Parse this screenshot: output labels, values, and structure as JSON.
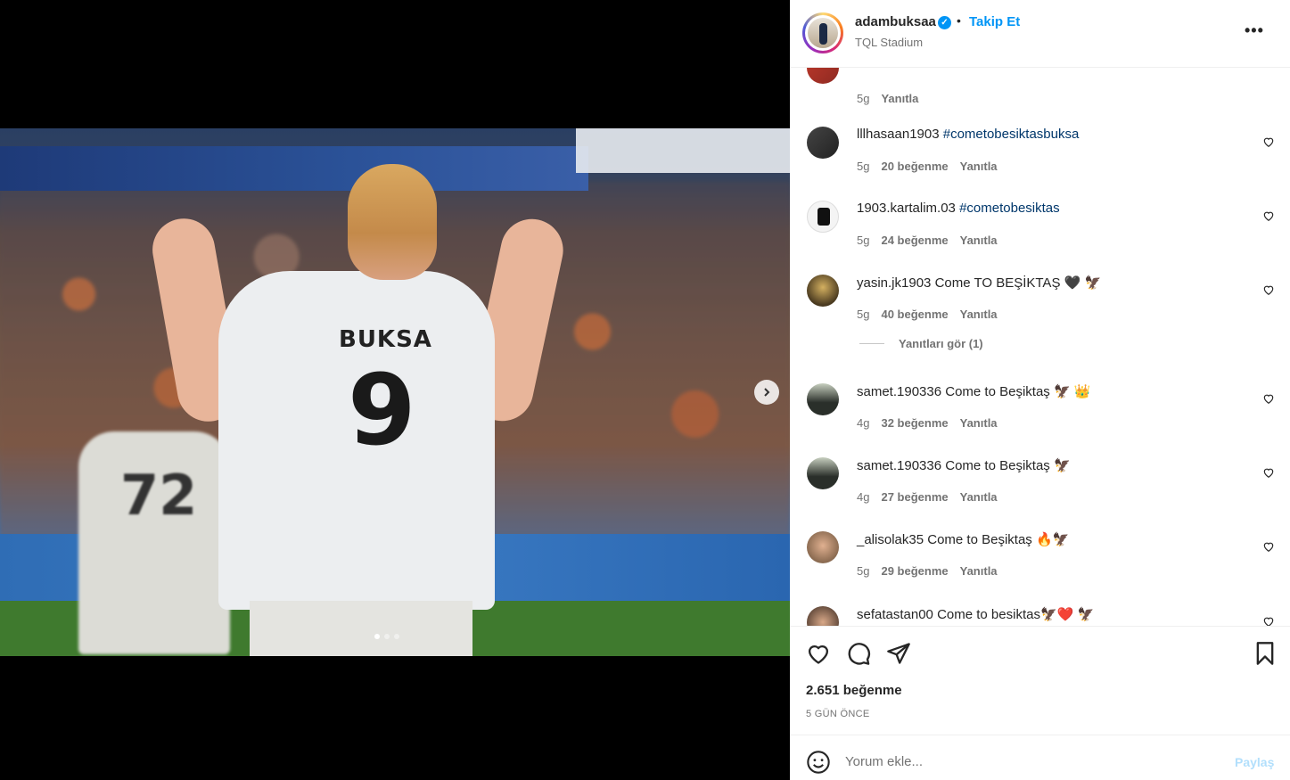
{
  "post": {
    "username": "adambuksaa",
    "verified_icon": "verified-badge-icon",
    "separator": "•",
    "follow_label": "Takip Et",
    "location": "TQL Stadium",
    "more_label": "•••",
    "jersey_name": "BUKSA",
    "jersey_number": "9",
    "background_player_number": "72",
    "carousel": {
      "total": 3,
      "active": 1
    }
  },
  "partial_top_comment": {
    "time": "5g",
    "reply_label": "Yanıtla"
  },
  "comments": [
    {
      "user": "lllhasaan1903",
      "text": "",
      "tag": "#cometobesiktasbuksa",
      "time": "5g",
      "likes": "20 beğenme",
      "reply": "Yanıtla"
    },
    {
      "user": "1903.kartalim.03",
      "text": "",
      "tag": "#cometobesiktas",
      "time": "5g",
      "likes": "24 beğenme",
      "reply": "Yanıtla"
    },
    {
      "user": "yasin.jk1903",
      "text": "Come TO BEŞİKTAŞ 🖤 🦅",
      "tag": "",
      "time": "5g",
      "likes": "40 beğenme",
      "reply": "Yanıtla"
    },
    {
      "user": "samet.190336",
      "text": "Come to Beşiktaş 🦅 👑",
      "tag": "",
      "time": "4g",
      "likes": "32 beğenme",
      "reply": "Yanıtla"
    },
    {
      "user": "samet.190336",
      "text": "Come to Beşiktaş 🦅",
      "tag": "",
      "time": "4g",
      "likes": "27 beğenme",
      "reply": "Yanıtla"
    },
    {
      "user": "_alisolak35",
      "text": "Come to Beşiktaş 🔥🦅",
      "tag": "",
      "time": "5g",
      "likes": "29 beğenme",
      "reply": "Yanıtla"
    },
    {
      "user": "sefatastan00",
      "text": "Come to besiktas🦅❤️ 🦅",
      "tag": "",
      "time": "",
      "likes": "",
      "reply": ""
    }
  ],
  "view_replies_label": "Yanıtları gör (1)",
  "actions": {
    "like_count": "2.651 beğenme",
    "date": "5 GÜN ÖNCE"
  },
  "add_comment": {
    "placeholder": "Yorum ekle...",
    "post_label": "Paylaş"
  },
  "colors": {
    "accent": "#0095f6",
    "link": "#00376b",
    "muted": "#737373"
  }
}
